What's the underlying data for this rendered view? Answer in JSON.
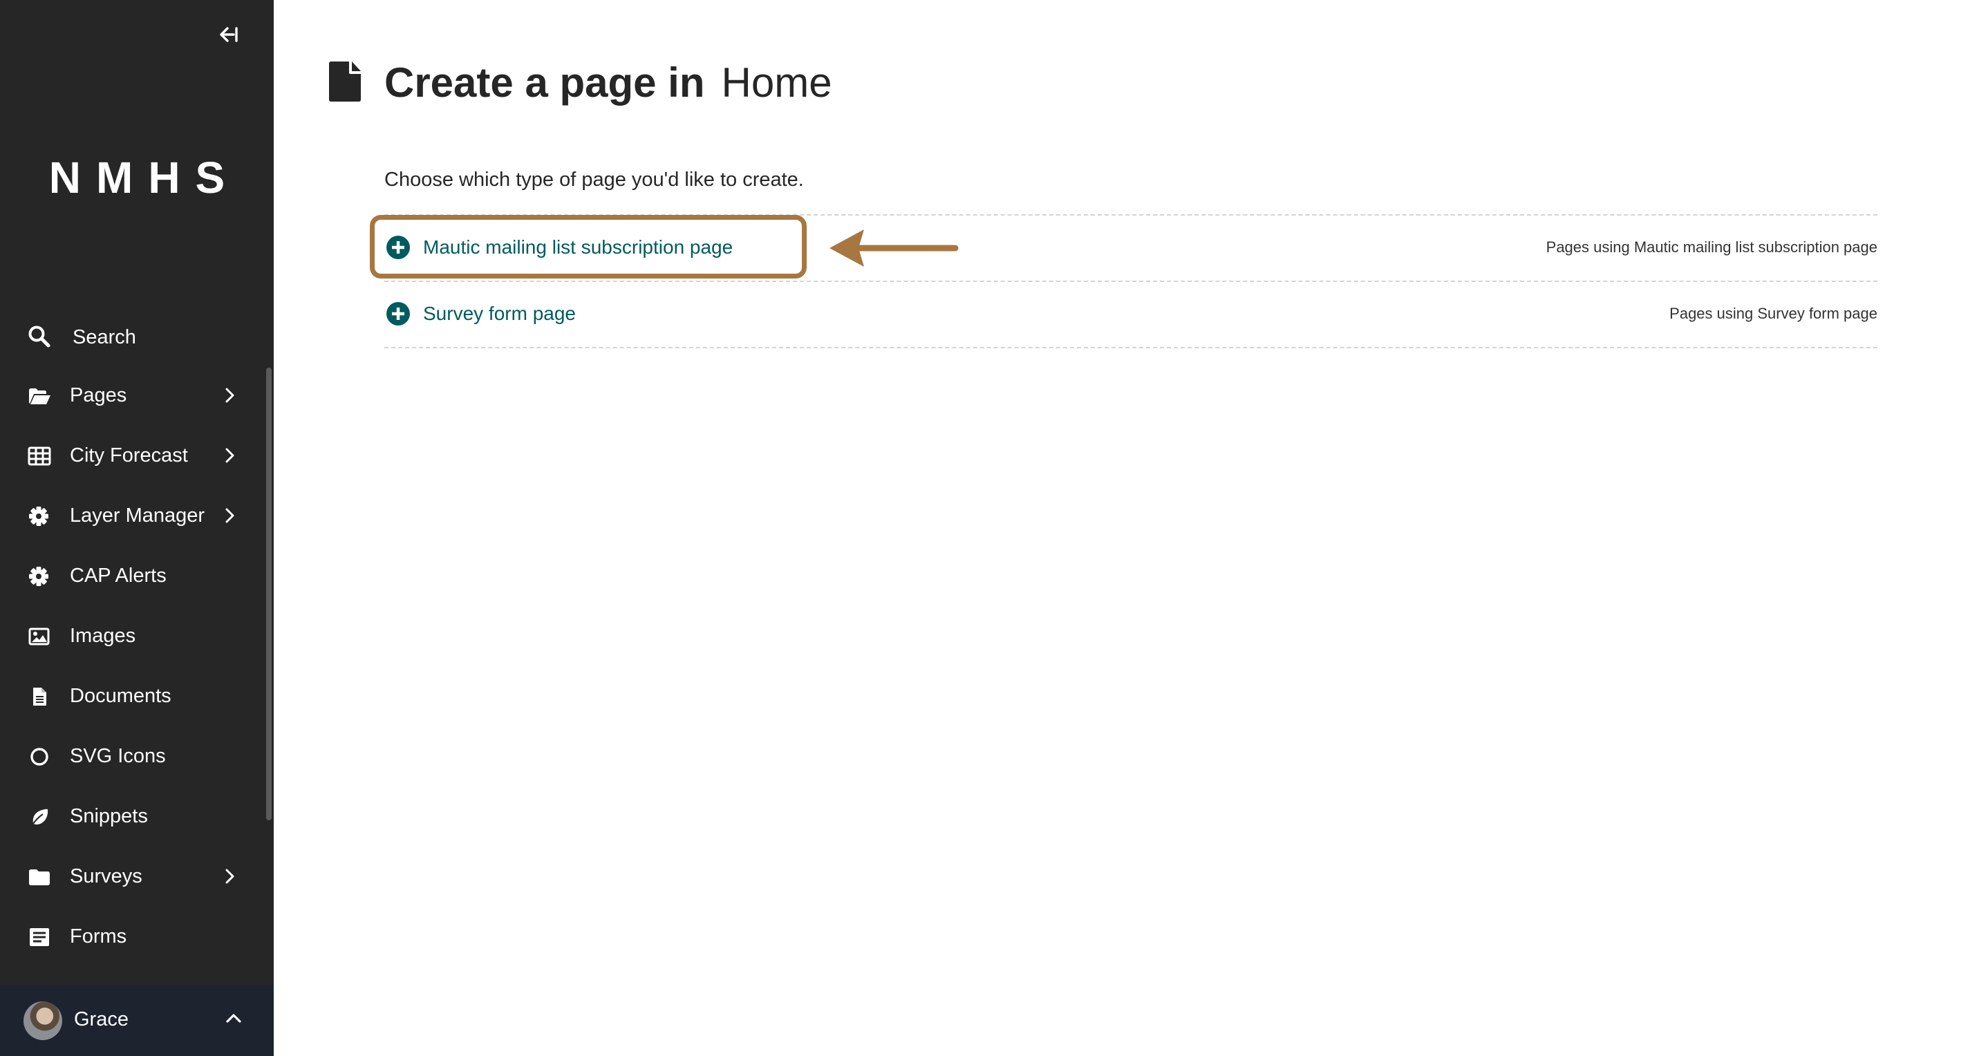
{
  "sidebar": {
    "logo": "NMHS",
    "search_label": "Search",
    "items": [
      {
        "label": "Pages",
        "icon": "folder-open-icon",
        "has_submenu": true
      },
      {
        "label": "City Forecast",
        "icon": "table-icon",
        "has_submenu": true
      },
      {
        "label": "Layer Manager",
        "icon": "cog-icon",
        "has_submenu": true
      },
      {
        "label": "CAP Alerts",
        "icon": "cog-icon",
        "has_submenu": false
      },
      {
        "label": "Images",
        "icon": "image-icon",
        "has_submenu": false
      },
      {
        "label": "Documents",
        "icon": "document-icon",
        "has_submenu": false
      },
      {
        "label": "SVG Icons",
        "icon": "circle-icon",
        "has_submenu": false
      },
      {
        "label": "Snippets",
        "icon": "leaf-icon",
        "has_submenu": false
      },
      {
        "label": "Surveys",
        "icon": "folder-icon",
        "has_submenu": true
      },
      {
        "label": "Forms",
        "icon": "list-icon",
        "has_submenu": false
      }
    ],
    "user": {
      "name": "Grace"
    }
  },
  "header": {
    "title_strong": "Create a page in",
    "title_context": "Home"
  },
  "main": {
    "intro": "Choose which type of page you'd like to create.",
    "page_types": [
      {
        "label": "Mautic mailing list subscription page",
        "usage": "Pages using Mautic mailing list subscription page"
      },
      {
        "label": "Survey form page",
        "usage": "Pages using Survey form page"
      }
    ]
  },
  "colors": {
    "sidebar_bg": "#262626",
    "user_bar_bg": "#1d2430",
    "link": "#005b5e",
    "annotation": "#a7773f"
  }
}
